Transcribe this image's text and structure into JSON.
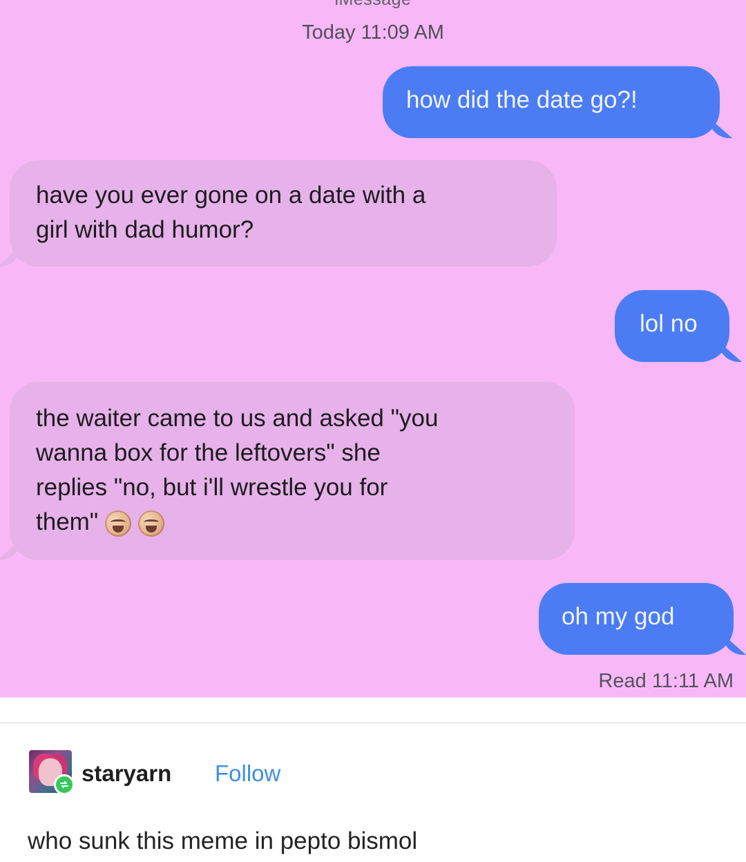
{
  "conversation": {
    "app_label": "iMessage",
    "timestamp": "Today 11:09 AM",
    "colors": {
      "background": "#f8b8f8",
      "sent": "#4b7cf3",
      "received": "#e7b1e9"
    },
    "messages": [
      {
        "side": "sent",
        "text": "how did the date go?!"
      },
      {
        "side": "received",
        "text": "have you ever gone on a date with a\ngirl with dad humor?"
      },
      {
        "side": "sent",
        "text": "lol no"
      },
      {
        "side": "received",
        "text": "the waiter came to us and asked \"you\nwanna box for the leftovers\" she\nreplies \"no, but i'll wrestle you for\nthem\"",
        "emojis": [
          "crying-face-icon",
          "crying-face-icon"
        ]
      },
      {
        "side": "sent",
        "text": "oh my god"
      }
    ],
    "read_receipt": "Read 11:11 AM"
  },
  "post": {
    "username": "staryarn",
    "follow_label": "Follow",
    "caption": "who sunk this meme in pepto bismol",
    "accent_color": "#3e8ee6",
    "reblog_color": "#37c85a"
  }
}
